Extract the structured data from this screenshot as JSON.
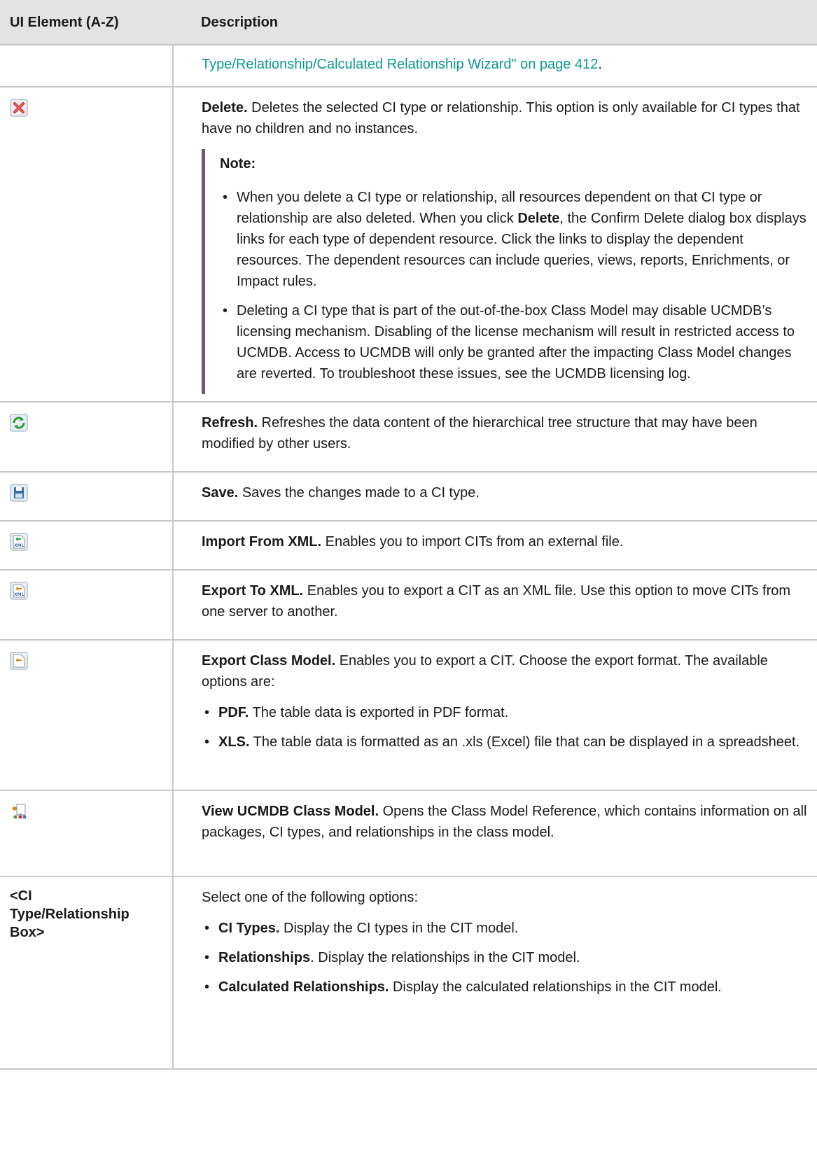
{
  "table": {
    "col1_header": "UI Element (A-Z)",
    "col2_header": "Description"
  },
  "rows": {
    "wizard_link": {
      "text": "Type/Relationship/Calculated Relationship Wizard\" on page 412",
      "suffix": "."
    },
    "delete": {
      "icon": "delete-icon",
      "title": "Delete.",
      "desc": " Deletes the selected CI type or relationship. This option is only available for CI types that have no children and no instances.",
      "note_title": "Note:",
      "note1_a": "When you delete a CI type or relationship, all resources dependent on that CI type or relationship are also deleted. When you click ",
      "note1_bold": "Delete",
      "note1_b": ", the Confirm Delete dialog box displays links for each type of dependent resource. Click the links to display the dependent resources. The dependent resources can include queries, views, reports, Enrichments, or Impact rules.",
      "note2": "Deleting a CI type that is part of the out-of-the-box Class Model may disable UCMDB’s licensing mechanism. Disabling of the license mechanism will result in restricted access to UCMDB. Access to UCMDB will only be granted after the impacting Class Model changes are reverted. To troubleshoot these issues, see the UCMDB licensing log."
    },
    "refresh": {
      "icon": "refresh-icon",
      "title": "Refresh.",
      "desc": " Refreshes the data content of the hierarchical tree structure that may have been modified by other users."
    },
    "save": {
      "icon": "save-icon",
      "title": "Save.",
      "desc": " Saves the changes made to a CI type."
    },
    "import_xml": {
      "icon": "import-xml-icon",
      "title": "Import From XML.",
      "desc": " Enables you to import CITs from an external file."
    },
    "export_xml": {
      "icon": "export-xml-icon",
      "title": "Export To XML.",
      "desc": " Enables you to export a CIT as an XML file. Use this option to move CITs from one server to another."
    },
    "export_class_model": {
      "icon": "export-class-model-icon",
      "title": "Export Class Model.",
      "desc": " Enables you to export a CIT. Choose the export format. The available options are:",
      "opt1_bold": "PDF.",
      "opt1_text": " The table data is exported in PDF format.",
      "opt2_bold": "XLS.",
      "opt2_text": " The table data is formatted as an .xls (Excel) file that can be displayed in a spreadsheet."
    },
    "view_class_model": {
      "icon": "view-class-model-icon",
      "title": "View UCMDB Class Model.",
      "desc": " Opens the Class Model Reference, which contains information on all packages, CI types, and relationships in the class model."
    },
    "ci_type_box": {
      "element_line1": "<CI",
      "element_line2": "Type/Relationship",
      "element_line3": "Box>",
      "intro": "Select one of the following options:",
      "opt1_bold": "CI Types.",
      "opt1_text": " Display the CI types in the CIT model.",
      "opt2_bold": "Relationships",
      "opt2_text": ". Display the relationships in the CIT model.",
      "opt3_bold": "Calculated Relationships.",
      "opt3_text": " Display the calculated relationships in the CIT model."
    }
  },
  "bullet_char": "•"
}
